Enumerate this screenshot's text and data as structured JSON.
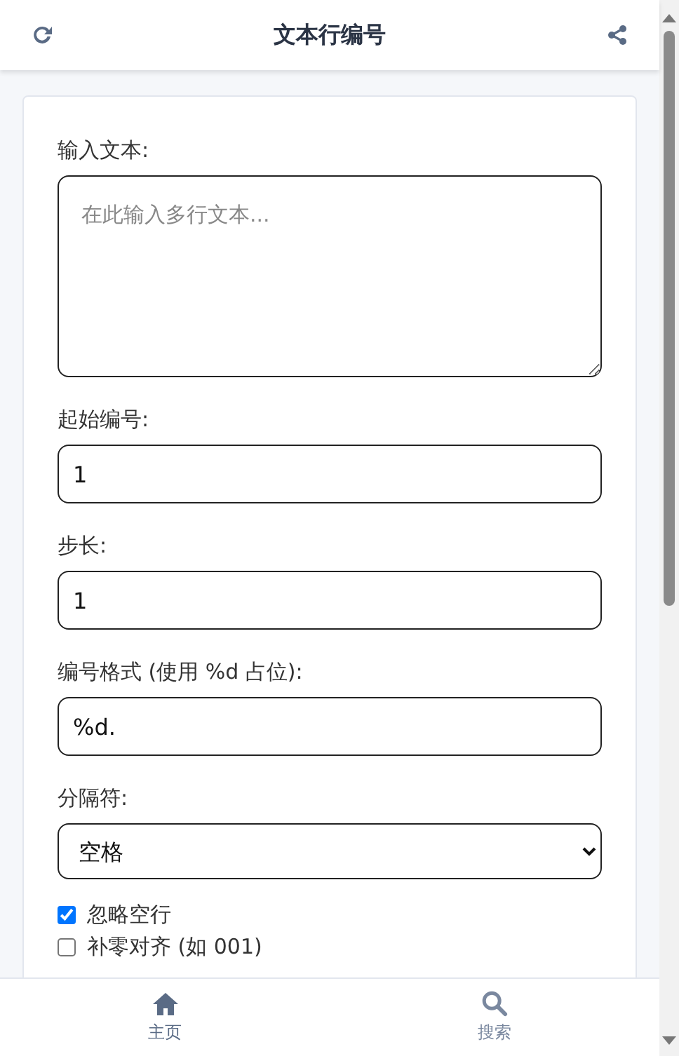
{
  "header": {
    "title": "文本行编号"
  },
  "form": {
    "fields": [
      {
        "kind": "textarea",
        "label": "输入文本:",
        "placeholder": "在此输入多行文本..."
      },
      {
        "kind": "input",
        "label": "起始编号:",
        "value": "1"
      },
      {
        "kind": "input",
        "label": "步长:",
        "value": "1"
      },
      {
        "kind": "input",
        "label": "编号格式 (使用 %d 占位):",
        "value": "%d."
      },
      {
        "kind": "select",
        "label": "分隔符:",
        "value": "空格"
      }
    ],
    "checkboxes": [
      {
        "label": "忽略空行",
        "checked": true
      },
      {
        "label": "补零对齐 (如 001)",
        "checked": false
      }
    ]
  },
  "bottom_nav": [
    {
      "label": "主页",
      "kind": "home",
      "selected": true
    },
    {
      "label": "搜索",
      "kind": "search",
      "selected": false
    }
  ]
}
